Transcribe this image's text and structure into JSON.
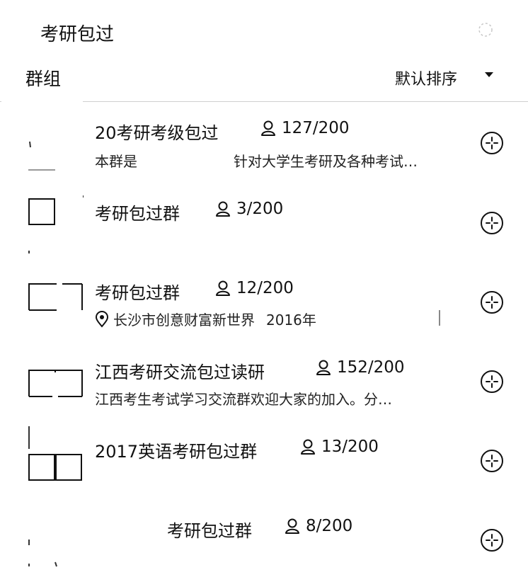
{
  "header": {
    "title": "考研包过"
  },
  "toolbar": {
    "section": "群组",
    "sort": "默认排序"
  },
  "groups": [
    {
      "name": "20考研考级包过",
      "members": "127/200",
      "desc_a": "本群是",
      "desc_b": "针对大学生考研及各种考试…"
    },
    {
      "name": "考研包过群",
      "members": "3/200"
    },
    {
      "name": "考研包过群",
      "members": "12/200",
      "location": "长沙市创意财富新世界",
      "year": "2016年"
    },
    {
      "name": "江西考研交流包过读研",
      "members": "152/200",
      "desc": "江西考生考试学习交流群欢迎大家的加入。分…"
    },
    {
      "name": "2017英语考研包过群",
      "members": "13/200"
    },
    {
      "name": "考研包过群",
      "members": "8/200"
    }
  ]
}
